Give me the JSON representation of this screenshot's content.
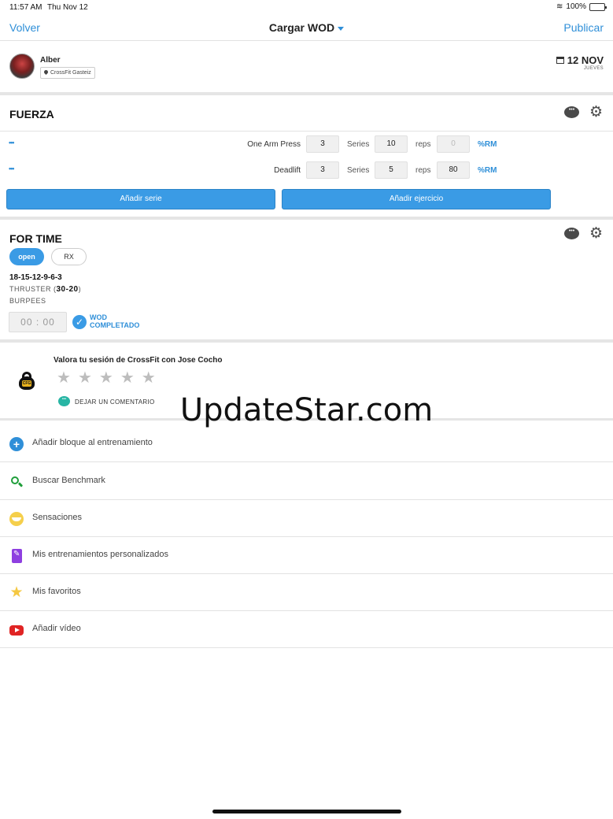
{
  "status_bar": {
    "time": "11:57 AM",
    "date": "Thu Nov 12",
    "battery": "100%",
    "battery_level": 1.0
  },
  "nav": {
    "back": "Volver",
    "title": "Cargar WOD",
    "publish": "Publicar"
  },
  "user": {
    "name": "Alber",
    "box": "CrossFit Gasteiz",
    "date_big": "12 NOV",
    "date_small": "JUEVES"
  },
  "fuerza": {
    "title": "FUERZA",
    "rows": [
      {
        "name": "One Arm Press",
        "sets": "3",
        "sets_label": "Series",
        "reps": "10",
        "reps_label": "reps",
        "rm": "0",
        "rm_label": "%RM"
      },
      {
        "name": "Deadlift",
        "sets": "3",
        "sets_label": "Series",
        "reps": "5",
        "reps_label": "reps",
        "rm": "80",
        "rm_label": "%RM"
      }
    ],
    "add_set": "Añadir serie",
    "add_exercise": "Añadir ejercicio"
  },
  "fortime": {
    "title": "FOR TIME",
    "pill_open": "open",
    "pill_rx": "RX",
    "scheme": "18-15-12-9-6-3",
    "line2_name": "THRUSTER (",
    "line2_weight": "30-20",
    "line2_end": ")",
    "line3": "BURPEES",
    "timer": "00 : 00",
    "done_1": "WOD",
    "done_2": "COMPLETADO"
  },
  "rating": {
    "title": "Valora tu sesión de CrossFit con Jose Cocho",
    "logo_text": "CFG",
    "stars": 0,
    "comment": "DEJAR UN COMENTARIO"
  },
  "watermark": "UpdateStar.com",
  "menu": [
    {
      "icon": "plus-circle-icon",
      "label": "Añadir bloque al entrenamiento"
    },
    {
      "icon": "search-icon",
      "label": "Buscar Benchmark"
    },
    {
      "icon": "smile-icon",
      "label": "Sensaciones"
    },
    {
      "icon": "clipboard-icon",
      "label": "Mis entrenamientos personalizados"
    },
    {
      "icon": "star-icon",
      "label": "Mis favoritos"
    },
    {
      "icon": "youtube-icon",
      "label": "Añadir vídeo"
    }
  ],
  "colors": {
    "accent": "#2f8fd8",
    "button": "#3a9be5",
    "star": "#bdbdbd"
  }
}
